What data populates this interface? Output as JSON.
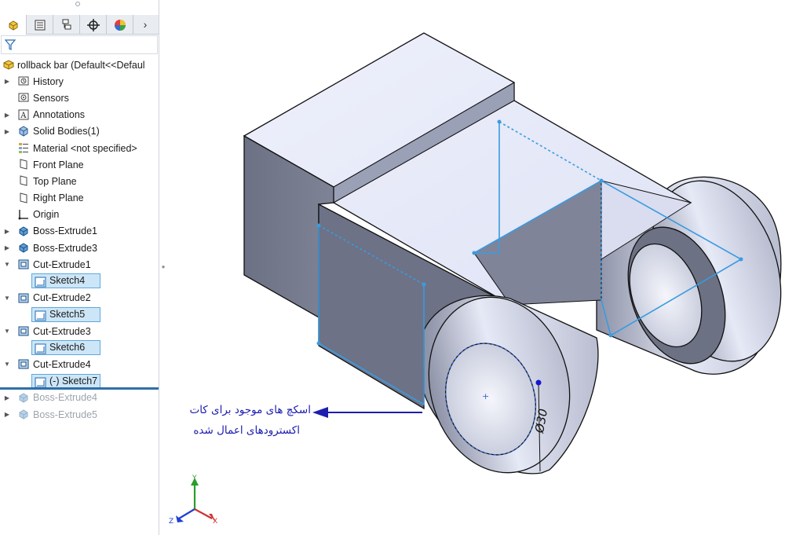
{
  "tabs": [
    "feature-manager",
    "property-manager",
    "configuration-manager",
    "dimxpert-manager",
    "display-manager"
  ],
  "tree": {
    "root": "rollback bar  (Default<<Defaul",
    "items": [
      {
        "label": "History",
        "icon": "history-icon",
        "expandable": true
      },
      {
        "label": "Sensors",
        "icon": "sensors-icon",
        "expandable": false
      },
      {
        "label": "Annotations",
        "icon": "annotations-icon",
        "expandable": true
      },
      {
        "label": "Solid Bodies(1)",
        "icon": "solid-bodies-icon",
        "expandable": true
      },
      {
        "label": "Material <not specified>",
        "icon": "material-icon",
        "expandable": false
      },
      {
        "label": "Front Plane",
        "icon": "plane-icon",
        "expandable": false
      },
      {
        "label": "Top Plane",
        "icon": "plane-icon",
        "expandable": false
      },
      {
        "label": "Right Plane",
        "icon": "plane-icon",
        "expandable": false
      },
      {
        "label": "Origin",
        "icon": "origin-icon",
        "expandable": false
      },
      {
        "label": "Boss-Extrude1",
        "icon": "boss-extrude-icon",
        "expandable": true
      },
      {
        "label": "Boss-Extrude3",
        "icon": "boss-extrude-icon",
        "expandable": true
      },
      {
        "label": "Cut-Extrude1",
        "icon": "cut-extrude-icon",
        "expandable": true,
        "expanded": true
      },
      {
        "label": "Sketch4",
        "icon": "sketch-icon",
        "child": true
      },
      {
        "label": "Cut-Extrude2",
        "icon": "cut-extrude-icon",
        "expandable": true,
        "expanded": true
      },
      {
        "label": "Sketch5",
        "icon": "sketch-icon",
        "child": true
      },
      {
        "label": "Cut-Extrude3",
        "icon": "cut-extrude-icon",
        "expandable": true,
        "expanded": true
      },
      {
        "label": "Sketch6",
        "icon": "sketch-icon",
        "child": true
      },
      {
        "label": "Cut-Extrude4",
        "icon": "cut-extrude-icon",
        "expandable": true,
        "expanded": true
      },
      {
        "label": "(-) Sketch7",
        "icon": "sketch-icon",
        "child": true
      },
      {
        "label": "Boss-Extrude4",
        "icon": "boss-extrude-icon",
        "expandable": true,
        "suppressed": true
      },
      {
        "label": "Boss-Extrude5",
        "icon": "boss-extrude-icon",
        "expandable": true,
        "suppressed": true
      }
    ]
  },
  "viewport": {
    "dimension_label": "Ø30",
    "annotation_line1": "اسکچ های موجود برای کات",
    "annotation_line2": "اکسترودهای اعمال شده",
    "triad": {
      "x": "X",
      "y": "Y",
      "z": "Z"
    }
  },
  "colors": {
    "selection": "#cde6f7",
    "rollback": "#2f6faa",
    "sketch": "#3a9be0",
    "annotation": "#1d1db0"
  }
}
